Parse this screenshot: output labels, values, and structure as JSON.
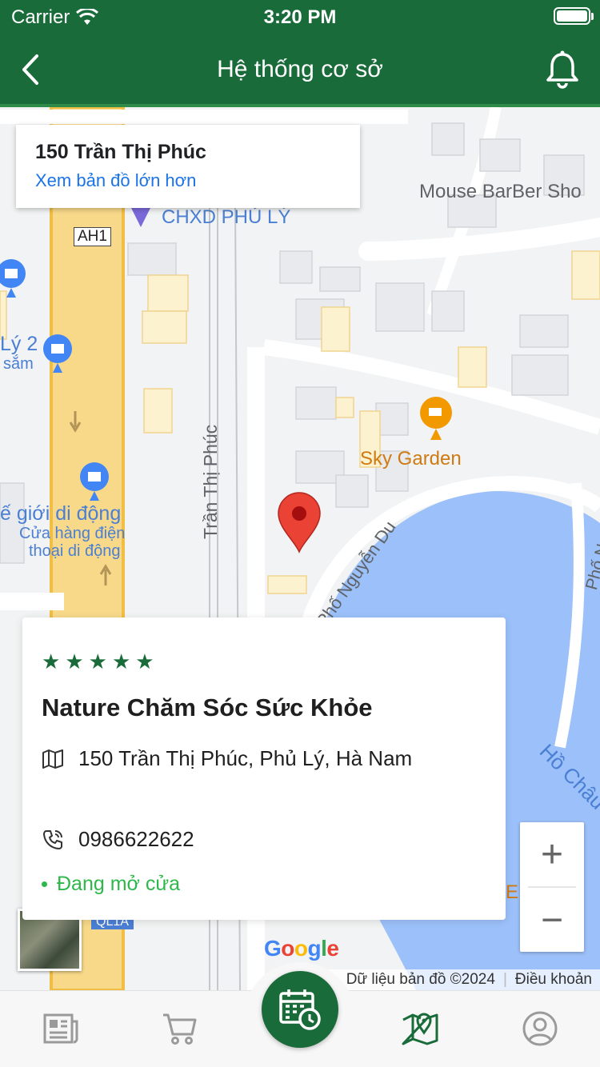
{
  "status_bar": {
    "carrier": "Carrier",
    "time": "3:20 PM"
  },
  "nav": {
    "title": "Hệ thống cơ sở"
  },
  "map": {
    "popup": {
      "address": "150 Trần Thị Phúc",
      "link": "Xem bản đồ lớn hơn"
    },
    "labels": {
      "mouse_barber": "Mouse BarBer Sho",
      "chxd": "CHXD PHỦ LÝ",
      "ah1": "AH1",
      "ly2_line1": "Lý 2",
      "ly2_line2": "sắm",
      "tran_thi_phuc": "Trần Thị Phúc",
      "sky_garden": "Sky Garden",
      "pho_nguyen_du_1": "Phố Nguyễn Du",
      "pho_nguyen_du_2": "Phố Nguyễn Du",
      "the_gioi_line1": "ế giới di động",
      "the_gioi_line2": "Cửa hàng điện",
      "the_gioi_line3": "thoại di động",
      "ho_chau": "Hồ Châu",
      "ql1a": "QL1A",
      "partial_e": "E"
    },
    "google": "Google",
    "attribution": {
      "partial": "Ph",
      "data": "Dữ liệu bản đồ ©2024",
      "terms": "Điều khoản"
    },
    "zoom": {
      "in": "+",
      "out": "−"
    }
  },
  "card": {
    "rating": 5,
    "stars": [
      "★",
      "★",
      "★",
      "★",
      "★"
    ],
    "name": "Nature Chăm Sóc Sức Khỏe",
    "address": "150 Trần Thị Phúc, Phủ Lý, Hà Nam",
    "phone": "0986622622",
    "status": "Đang mở cửa"
  },
  "colors": {
    "brand": "#1a6b3a",
    "open": "#2eb84b",
    "link": "#1a73e8",
    "water": "#9cc0f9",
    "pin": "#ea4335"
  },
  "icons": [
    "back-icon",
    "bell-icon",
    "map-fold-icon",
    "phone-icon",
    "newspaper-icon",
    "cart-icon",
    "calendar-clock-icon",
    "map-pin-icon",
    "user-icon"
  ]
}
